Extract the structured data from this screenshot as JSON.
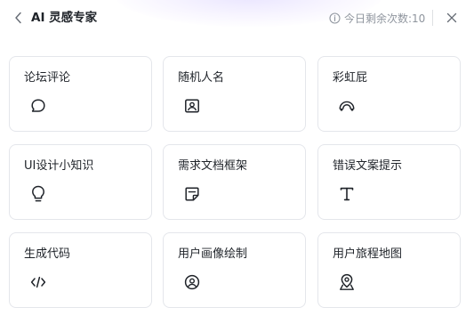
{
  "header": {
    "title": "AI 灵感专家",
    "quota_text": "今日剩余次数:10"
  },
  "cards": [
    {
      "label": "论坛评论",
      "icon": "chat-bubble-icon"
    },
    {
      "label": "随机人名",
      "icon": "portrait-icon"
    },
    {
      "label": "彩虹屁",
      "icon": "rainbow-icon"
    },
    {
      "label": "UI设计小知识",
      "icon": "lightbulb-icon"
    },
    {
      "label": "需求文档框架",
      "icon": "sticky-note-icon"
    },
    {
      "label": "错误文案提示",
      "icon": "text-t-icon"
    },
    {
      "label": "生成代码",
      "icon": "code-icon"
    },
    {
      "label": "用户画像绘制",
      "icon": "user-circle-icon"
    },
    {
      "label": "用户旅程地图",
      "icon": "map-pin-icon"
    }
  ]
}
